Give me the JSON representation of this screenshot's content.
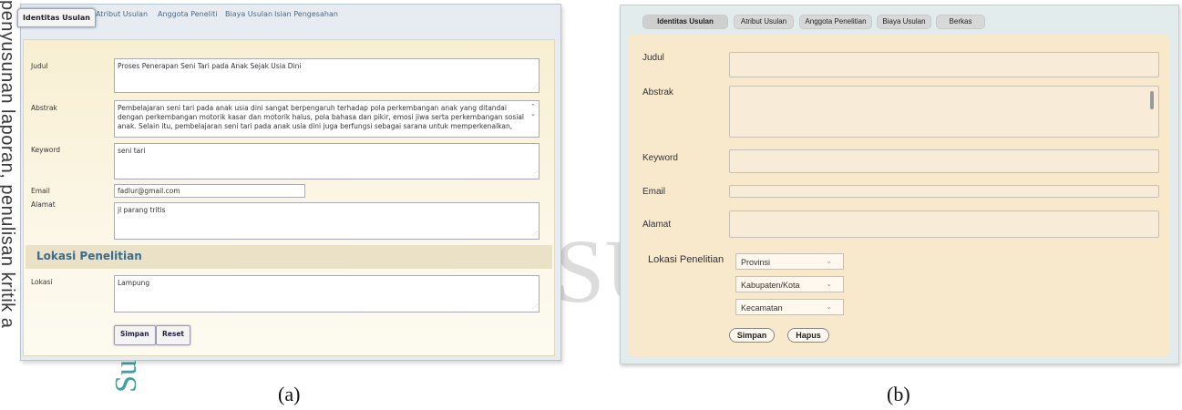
{
  "panel_a": {
    "tabs": [
      "Identitas Usulan",
      "Atribut Usulan",
      "Anggota Peneliti",
      "Biaya Usulan",
      "Isian Pengesahan"
    ],
    "fields": {
      "judul_label": "Judul",
      "judul_value": "Proses Penerapan Seni Tari pada Anak Sejak Usia Dini",
      "abstrak_label": "Abstrak",
      "abstrak_value": "Pembelajaran seni tari pada anak usia dini sangat berpengaruh terhadap pola perkembangan anak yang ditandai dengan perkembangan motorik kasar dan motorik halus, pola bahasa dan pikir, emosi jiwa serta perkembangan sosial anak. Selain itu, pembelajaran seni tari pada anak usia dini juga berfungsi sebagai sarana untuk memperkenalkan,",
      "keyword_label": "Keyword",
      "keyword_value": "seni tari",
      "email_label": "Email",
      "email_value": "fadlur@gmail.com",
      "alamat_label": "Alamat",
      "alamat_value": "jl parang tritis"
    },
    "section_title": "Lokasi Penelitian",
    "lokasi_label": "Lokasi",
    "lokasi_value": "Lampung",
    "buttons": {
      "save": "Simpan",
      "reset": "Reset"
    }
  },
  "panel_b": {
    "tabs": [
      "Identitas Usulan",
      "Atribut Usulan",
      "Anggota Penelitian",
      "Biaya Usulan",
      "Berkas"
    ],
    "labels": {
      "judul": "Judul",
      "abstrak": "Abstrak",
      "keyword": "Keyword",
      "email": "Email",
      "alamat": "Alamat",
      "lokasi": "Lokasi Penelitian"
    },
    "selects": [
      "Provinsi",
      "Kabupaten/Kota",
      "Kecamatan"
    ],
    "buttons": {
      "save": "Simpan",
      "delete": "Hapus"
    }
  },
  "captions": {
    "a": "(a)",
    "b": "(b)"
  },
  "background": {
    "side_text": "penyusunan laporan, penulisan kritik a",
    "watermark_text": "SU",
    "side_logo_text": "Su"
  },
  "colors": {
    "panel_a_content": "#fcf6e3",
    "panel_a_section": "#ebe1c6",
    "panel_a_section_text": "#3a6c8c",
    "panel_b_content": "#f8e8cc",
    "panel_b_frame": "#e2ecec"
  },
  "icons": {
    "dropdown": "chevron-down-icon",
    "resize": "resize-grip-icon"
  }
}
